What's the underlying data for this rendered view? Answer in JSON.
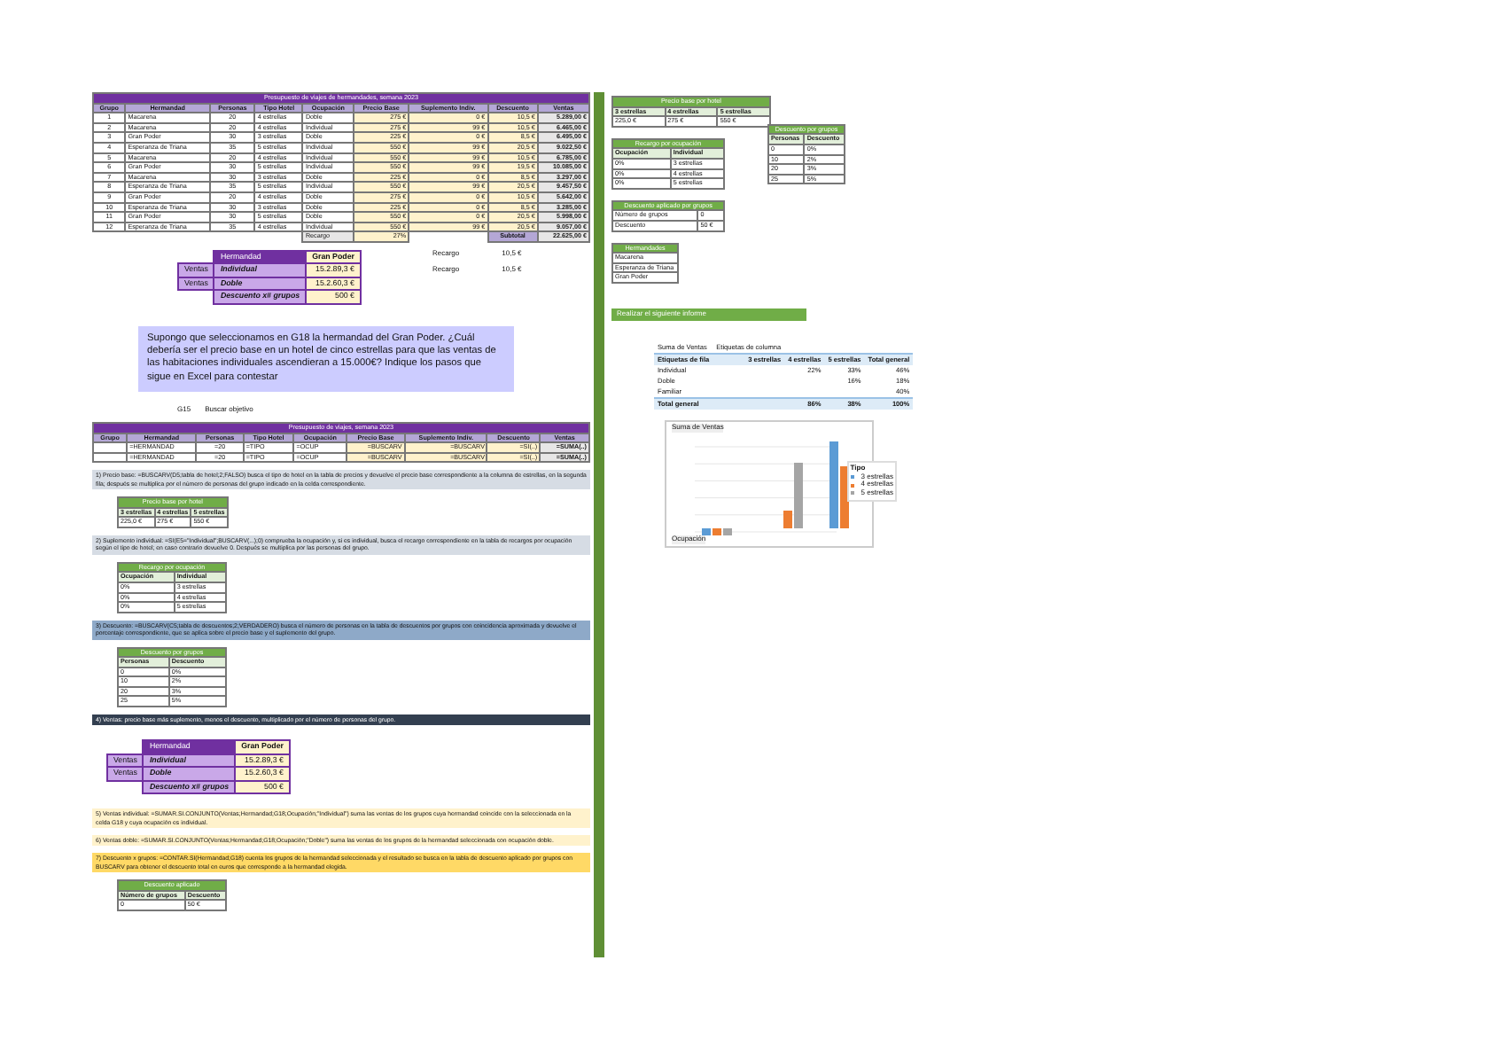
{
  "main_table": {
    "title": "Presupuesto de viajes de hermandades, semana 2023",
    "columns": [
      "Grupo",
      "Hermandad",
      "Personas",
      "Tipo Hotel",
      "Ocupación",
      "Precio Base",
      "Suplemento Indiv.",
      "Descuento",
      "Ventas"
    ],
    "rows": [
      [
        "1",
        "Macarena",
        "20",
        "4 estrellas",
        "Doble",
        "275 €",
        "0 €",
        "10,5 €",
        "5.289,00 €"
      ],
      [
        "2",
        "Macarena",
        "20",
        "4 estrellas",
        "Individual",
        "275 €",
        "99 €",
        "10,5 €",
        "6.465,00 €"
      ],
      [
        "3",
        "Gran Poder",
        "30",
        "3 estrellas",
        "Doble",
        "225 €",
        "0 €",
        "8,5 €",
        "6.495,00 €"
      ],
      [
        "4",
        "Esperanza de Triana",
        "35",
        "5 estrellas",
        "Individual",
        "550 €",
        "99 €",
        "20,5 €",
        "9.022,50 €"
      ],
      [
        "5",
        "Macarena",
        "20",
        "4 estrellas",
        "Individual",
        "550 €",
        "99 €",
        "10,5 €",
        "6.785,00 €"
      ],
      [
        "6",
        "Gran Poder",
        "30",
        "5 estrellas",
        "Individual",
        "550 €",
        "99 €",
        "19,5 €",
        "10.085,00 €"
      ],
      [
        "7",
        "Macarena",
        "30",
        "3 estrellas",
        "Doble",
        "225 €",
        "0 €",
        "8,5 €",
        "3.297,00 €"
      ],
      [
        "8",
        "Esperanza de Triana",
        "35",
        "5 estrellas",
        "Individual",
        "550 €",
        "99 €",
        "20,5 €",
        "9.457,50 €"
      ],
      [
        "9",
        "Gran Poder",
        "20",
        "4 estrellas",
        "Doble",
        "275 €",
        "0 €",
        "10,5 €",
        "5.642,00 €"
      ],
      [
        "10",
        "Esperanza de Triana",
        "30",
        "3 estrellas",
        "Doble",
        "225 €",
        "0 €",
        "8,5 €",
        "3.285,00 €"
      ],
      [
        "11",
        "Gran Poder",
        "30",
        "5 estrellas",
        "Doble",
        "550 €",
        "0 €",
        "20,5 €",
        "5.998,00 €"
      ],
      [
        "12",
        "Esperanza de Triana",
        "35",
        "4 estrellas",
        "Individual",
        "550 €",
        "99 €",
        "20,5 €",
        "9.057,00 €"
      ]
    ],
    "discount_label": "Recargo",
    "discount_value": "27%",
    "subtotal_label": "Subtotal",
    "subtotal_value": "22.625,00 €"
  },
  "summary": {
    "rows": [
      {
        "side": "",
        "label": "Hermandad",
        "value": "Gran Poder"
      },
      {
        "side": "Ventas",
        "label": "Individual",
        "value": "15.2.89,3 €"
      },
      {
        "side": "Ventas",
        "label": "Doble",
        "value": "15.2.60,3 €"
      },
      {
        "side": "",
        "label": "Descuento x# grupos",
        "value": "500 €"
      }
    ],
    "notes": [
      {
        "label": "Recargo",
        "value": "10,5 €"
      },
      {
        "label": "Recargo",
        "value": "10,5 €"
      }
    ]
  },
  "question": "Supongo que seleccionamos en G18 la hermandad del Gran Poder. ¿Cuál debería ser el precio base en un hotel de cinco estrellas para que las ventas de las habitaciones individuales ascendieran a 15.000€? Indique los pasos que sigue en Excel para contestar",
  "goal_seek": {
    "cell": "G15",
    "label": "Buscar objetivo"
  },
  "table2": {
    "title": "Presupuesto de viajes, semana 2023",
    "columns": [
      "Grupo",
      "Hermandad",
      "Personas",
      "Tipo Hotel",
      "Ocupación",
      "Precio Base",
      "Suplemento Indiv.",
      "Descuento",
      "Ventas"
    ],
    "rows": [
      [
        "",
        "=HERMANDAD",
        "=20",
        "=TIPO",
        "=OCUP",
        "=BUSCARV",
        "=BUSCARV",
        "=SI(..)",
        "=SUMA(..)"
      ],
      [
        "",
        "=HERMANDAD",
        "=20",
        "=TIPO",
        "=OCUP",
        "=BUSCARV",
        "=BUSCARV",
        "=SI(..)",
        "=SUMA(..)"
      ]
    ]
  },
  "blocks": [
    {
      "kind": "note",
      "color": "#d6dce4",
      "text": "1) Precio base: =BUSCARV(D5;tabla de hotel;2;FALSO) busca el tipo de hotel en la tabla de precios y devuelve el precio base correspondiente a la columna de estrellas, en la segunda fila; después se multiplica por el número de personas del grupo indicado en la celda correspondiente."
    },
    {
      "kind": "table",
      "title": "Precio base por hotel",
      "columns": [
        "3 estrellas",
        "4 estrellas",
        "5 estrellas"
      ],
      "rows": [
        [
          "225,0 €",
          "275 €",
          "550 €"
        ]
      ]
    },
    {
      "kind": "note",
      "color": "#d6dce4",
      "text": "2) Suplemento individual: =SI(E5=\"Individual\";BUSCARV(...);0) comprueba la ocupación y, si es individual, busca el recargo correspondiente en la tabla de recargos por ocupación según el tipo de hotel; en caso contrario devuelve 0. Después se multiplica por las personas del grupo."
    },
    {
      "kind": "table",
      "title": "Recargo por ocupación",
      "columns": [
        "Ocupación",
        "Individual"
      ],
      "rows": [
        [
          "0%",
          "3 estrellas"
        ],
        [
          "0%",
          "4 estrellas"
        ],
        [
          "0%",
          "5 estrellas"
        ]
      ]
    },
    {
      "kind": "note",
      "color": "#8ea9c8",
      "text": "3) Descuento: =BUSCARV(C5;tabla de descuentos;2;VERDADERO) busca el número de personas en la tabla de descuentos por grupos con coincidencia aproximada y devuelve el porcentaje correspondiente, que se aplica sobre el precio base y el suplemento del grupo."
    },
    {
      "kind": "table",
      "title": "Descuento por grupos",
      "columns": [
        "Personas",
        "Descuento"
      ],
      "rows": [
        [
          "0",
          "0%"
        ],
        [
          "10",
          "2%"
        ],
        [
          "20",
          "3%"
        ],
        [
          "25",
          "5%"
        ]
      ]
    },
    {
      "kind": "note",
      "color": "#333f50",
      "text": "4) Ventas: precio base más suplemento, menos el descuento, multiplicado por el número de personas del grupo."
    },
    {
      "kind": "summary",
      "rows": [
        {
          "side": "",
          "label": "Hermandad",
          "value": "Gran Poder"
        },
        {
          "side": "Ventas",
          "label": "Individual",
          "value": "15.2.89,3 €"
        },
        {
          "side": "Ventas",
          "label": "Doble",
          "value": "15.2.60,3 €"
        },
        {
          "side": "",
          "label": "Descuento x# grupos",
          "value": "500 €"
        }
      ]
    },
    {
      "kind": "note",
      "color": "#fff2cc",
      "text": "5) Ventas individual: =SUMAR.SI.CONJUNTO(Ventas;Hermandad;G18;Ocupación;\"Individual\") suma las ventas de los grupos cuya hermandad coincide con la seleccionada en la celda G18 y cuya ocupación es individual."
    },
    {
      "kind": "note",
      "color": "#fff2cc",
      "text": "6) Ventas doble: =SUMAR.SI.CONJUNTO(Ventas;Hermandad;G18;Ocupación;\"Doble\") suma las ventas de los grupos de la hermandad seleccionada con ocupación doble."
    },
    {
      "kind": "note",
      "color": "#ffd966",
      "text": "7) Descuento x grupos: =CONTAR.SI(Hermandad;G18) cuenta los grupos de la hermandad seleccionada y el resultado se busca en la tabla de descuento aplicado por grupos con BUSCARV para obtener el descuento total en euros que corresponde a la hermandad elegida."
    },
    {
      "kind": "table",
      "title": "Descuento aplicado",
      "columns": [
        "Número de grupos",
        "Descuento"
      ],
      "rows": [
        [
          "0",
          "50 €"
        ]
      ]
    }
  ],
  "right": {
    "price_table": {
      "title": "Precio base por hotel",
      "columns": [
        "3 estrellas",
        "4 estrellas",
        "5 estrellas"
      ],
      "rows": [
        [
          "225,0 €",
          "275 €",
          "550 €"
        ]
      ]
    },
    "surcharge_table": {
      "title": "Recargo por ocupación",
      "columns": [
        "Ocupación",
        "Individual"
      ],
      "rows": [
        [
          "0%",
          "3 estrellas"
        ],
        [
          "0%",
          "4 estrellas"
        ],
        [
          "0%",
          "5 estrellas"
        ]
      ]
    },
    "group_table": {
      "title": "Descuento por grupos",
      "columns": [
        "Personas",
        "Descuento"
      ],
      "rows": [
        [
          "0",
          "0%"
        ],
        [
          "10",
          "2%"
        ],
        [
          "20",
          "3%"
        ],
        [
          "25",
          "5%"
        ]
      ]
    },
    "applied_table": {
      "title": "Descuento aplicado por grupos",
      "rows": [
        [
          "Número de grupos",
          "0"
        ],
        [
          "Descuento",
          "50 €"
        ]
      ]
    },
    "hermandades": {
      "title": "Hermandades",
      "items": [
        "Macarena",
        "Esperanza de Triana",
        "Gran Poder"
      ]
    },
    "report_title": "Realizar el siguiente informe",
    "pivot": {
      "columns": [
        "Suma de Ventas",
        "Etiquetas de columna",
        "",
        "",
        ""
      ],
      "header": [
        "Etiquetas de fila",
        "3 estrellas",
        "4 estrellas",
        "5 estrellas",
        "Total general"
      ],
      "rows": [
        [
          "Individual",
          "",
          "22%",
          "33%",
          "46%"
        ],
        [
          "Doble",
          "",
          "",
          "16%",
          "18%"
        ],
        [
          "Familiar",
          "",
          "",
          "",
          "40%"
        ],
        [
          "Total general",
          "",
          "86%",
          "38%",
          "100%"
        ]
      ]
    },
    "chart": {
      "title": "Suma de Ventas",
      "axis_label": "Ocupación",
      "legend_title": "Tipo",
      "legend": [
        "3 estrellas",
        "4 estrellas",
        "5 estrellas"
      ]
    }
  }
}
